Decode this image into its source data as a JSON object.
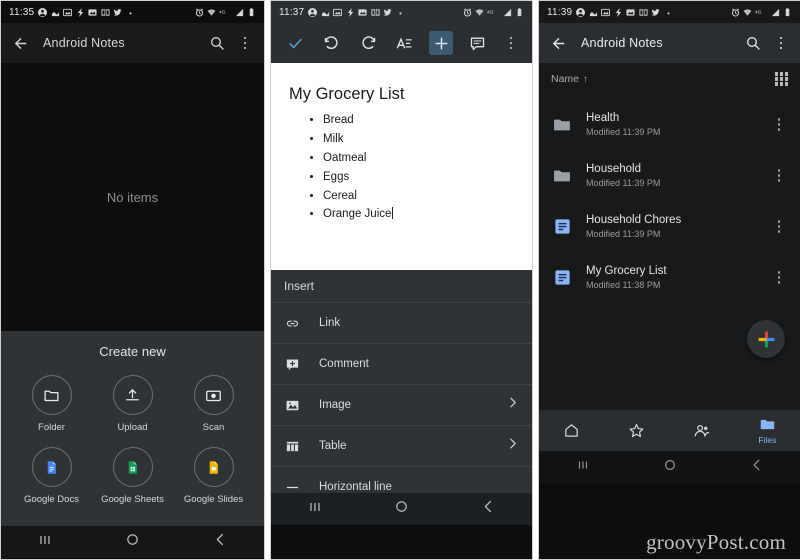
{
  "panel1": {
    "status": {
      "time": "11:35",
      "left_icons": [
        "account-icon",
        "wave-icon",
        "photos-icon",
        "flash-icon",
        "gallery-icon",
        "book-icon",
        "twitter-icon",
        "dot-icon"
      ],
      "right_icons": [
        "alarm-icon",
        "wifi-icon",
        "network-4g-icon",
        "signal-icon",
        "battery-icon"
      ]
    },
    "appbar": {
      "back": "back-arrow-icon",
      "title": "Android Notes",
      "search": "search-icon",
      "overflow": "overflow-menu-icon"
    },
    "empty_state": "No items",
    "create_new": {
      "title": "Create new",
      "items": [
        {
          "label": "Folder",
          "icon": "folder-icon"
        },
        {
          "label": "Upload",
          "icon": "upload-icon"
        },
        {
          "label": "Scan",
          "icon": "camera-scan-icon"
        },
        {
          "label": "Google Docs",
          "icon": "google-docs-icon"
        },
        {
          "label": "Google Sheets",
          "icon": "google-sheets-icon"
        },
        {
          "label": "Google Slides",
          "icon": "google-slides-icon"
        }
      ]
    },
    "sysnav": [
      "recents-icon",
      "home-icon",
      "back-icon"
    ]
  },
  "panel2": {
    "status": {
      "time": "11:37"
    },
    "toolbar": [
      {
        "name": "accept-check",
        "icon": "check-icon",
        "active": false
      },
      {
        "name": "undo",
        "icon": "undo-icon",
        "active": false
      },
      {
        "name": "redo",
        "icon": "redo-icon",
        "active": false
      },
      {
        "name": "text-format",
        "icon": "text-format-icon",
        "active": false
      },
      {
        "name": "insert",
        "icon": "plus-icon",
        "active": true
      },
      {
        "name": "comment",
        "icon": "comment-icon",
        "active": false
      },
      {
        "name": "overflow",
        "icon": "overflow-menu-icon",
        "active": false
      }
    ],
    "document": {
      "title": "My Grocery List",
      "items": [
        "Bread",
        "Milk",
        "Oatmeal",
        "Eggs",
        "Cereal",
        "Orange Juice"
      ]
    },
    "insert_sheet": {
      "header": "Insert",
      "items": [
        {
          "label": "Link",
          "icon": "link-icon",
          "submenu": false
        },
        {
          "label": "Comment",
          "icon": "add-comment-icon",
          "submenu": false
        },
        {
          "label": "Image",
          "icon": "image-icon",
          "submenu": true
        },
        {
          "label": "Table",
          "icon": "table-icon",
          "submenu": true
        },
        {
          "label": "Horizontal line",
          "icon": "horizontal-line-icon",
          "submenu": false
        }
      ]
    }
  },
  "panel3": {
    "status": {
      "time": "11:39"
    },
    "appbar": {
      "title": "Android Notes"
    },
    "sort": {
      "label": "Name",
      "direction": "↑",
      "view_toggle": "grid-view-icon"
    },
    "files": [
      {
        "name": "Health",
        "modified": "Modified 11:39 PM",
        "type": "folder"
      },
      {
        "name": "Household",
        "modified": "Modified 11:39 PM",
        "type": "folder"
      },
      {
        "name": "Household Chores",
        "modified": "Modified 11:39 PM",
        "type": "doc"
      },
      {
        "name": "My Grocery List",
        "modified": "Modified 11:38 PM",
        "type": "doc"
      }
    ],
    "fab": "google-create-plus-icon",
    "bottom_nav": [
      {
        "label": "",
        "icon": "home-icon",
        "selected": false
      },
      {
        "label": "",
        "icon": "starred-icon",
        "selected": false
      },
      {
        "label": "",
        "icon": "shared-icon",
        "selected": false
      },
      {
        "label": "Files",
        "icon": "files-folder-icon",
        "selected": true
      }
    ]
  },
  "watermark": "groovyPost.com",
  "colors": {
    "accent_blue": "#4285f4",
    "docs_blue": "#4285f4",
    "sheets_green": "#0f9d58",
    "slides_yellow": "#f4b400",
    "google_red": "#db4437",
    "selected_nav": "#8ab4f8",
    "toolbar_active": "#3d5a73"
  }
}
